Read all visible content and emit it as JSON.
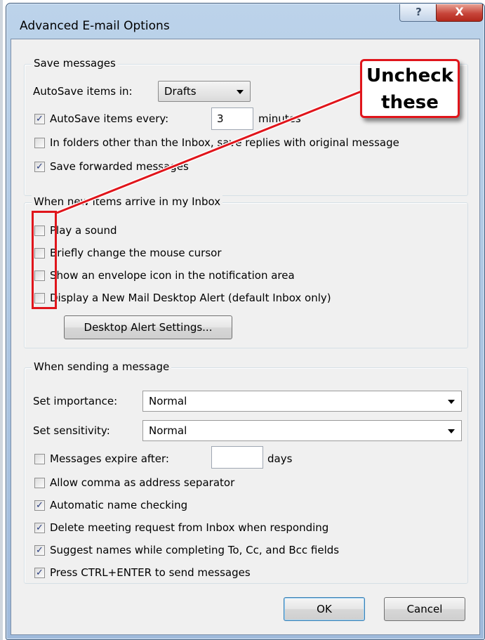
{
  "window": {
    "title": "Advanced E-mail Options",
    "help_glyph": "?",
    "close_glyph": "X"
  },
  "save_messages": {
    "title": "Save messages",
    "autosave_in_label": "AutoSave items in:",
    "autosave_in_value": "Drafts",
    "autosave_every": {
      "label": "AutoSave items every:",
      "checked": true,
      "value": "3",
      "unit": "minutes"
    },
    "save_replies": {
      "label": "In folders other than the Inbox, save replies with original message",
      "checked": false
    },
    "save_forwarded": {
      "label": "Save forwarded messages",
      "checked": true
    }
  },
  "new_items": {
    "title": "When new items arrive in my Inbox",
    "options": [
      {
        "label": "Play a sound",
        "checked": false
      },
      {
        "label": "Briefly change the mouse cursor",
        "checked": false
      },
      {
        "label": "Show an envelope icon in the notification area",
        "checked": false
      },
      {
        "label": "Display a New Mail Desktop Alert (default Inbox only)",
        "checked": false
      }
    ],
    "alert_settings_button": "Desktop Alert Settings..."
  },
  "sending": {
    "title": "When sending a message",
    "importance_label": "Set importance:",
    "importance_value": "Normal",
    "sensitivity_label": "Set sensitivity:",
    "sensitivity_value": "Normal",
    "expire": {
      "label": "Messages expire after:",
      "checked": false,
      "value": "",
      "unit": "days"
    },
    "options": [
      {
        "label": "Allow comma as address separator",
        "checked": false
      },
      {
        "label": "Automatic name checking",
        "checked": true
      },
      {
        "label": "Delete meeting request from Inbox when responding",
        "checked": true
      },
      {
        "label": "Suggest names while completing To, Cc, and Bcc fields",
        "checked": true
      },
      {
        "label": "Press CTRL+ENTER to send messages",
        "checked": true
      }
    ]
  },
  "buttons": {
    "ok": "OK",
    "cancel": "Cancel"
  },
  "annotation": {
    "line1": "Uncheck",
    "line2": "these",
    "color": "#e0151b"
  }
}
